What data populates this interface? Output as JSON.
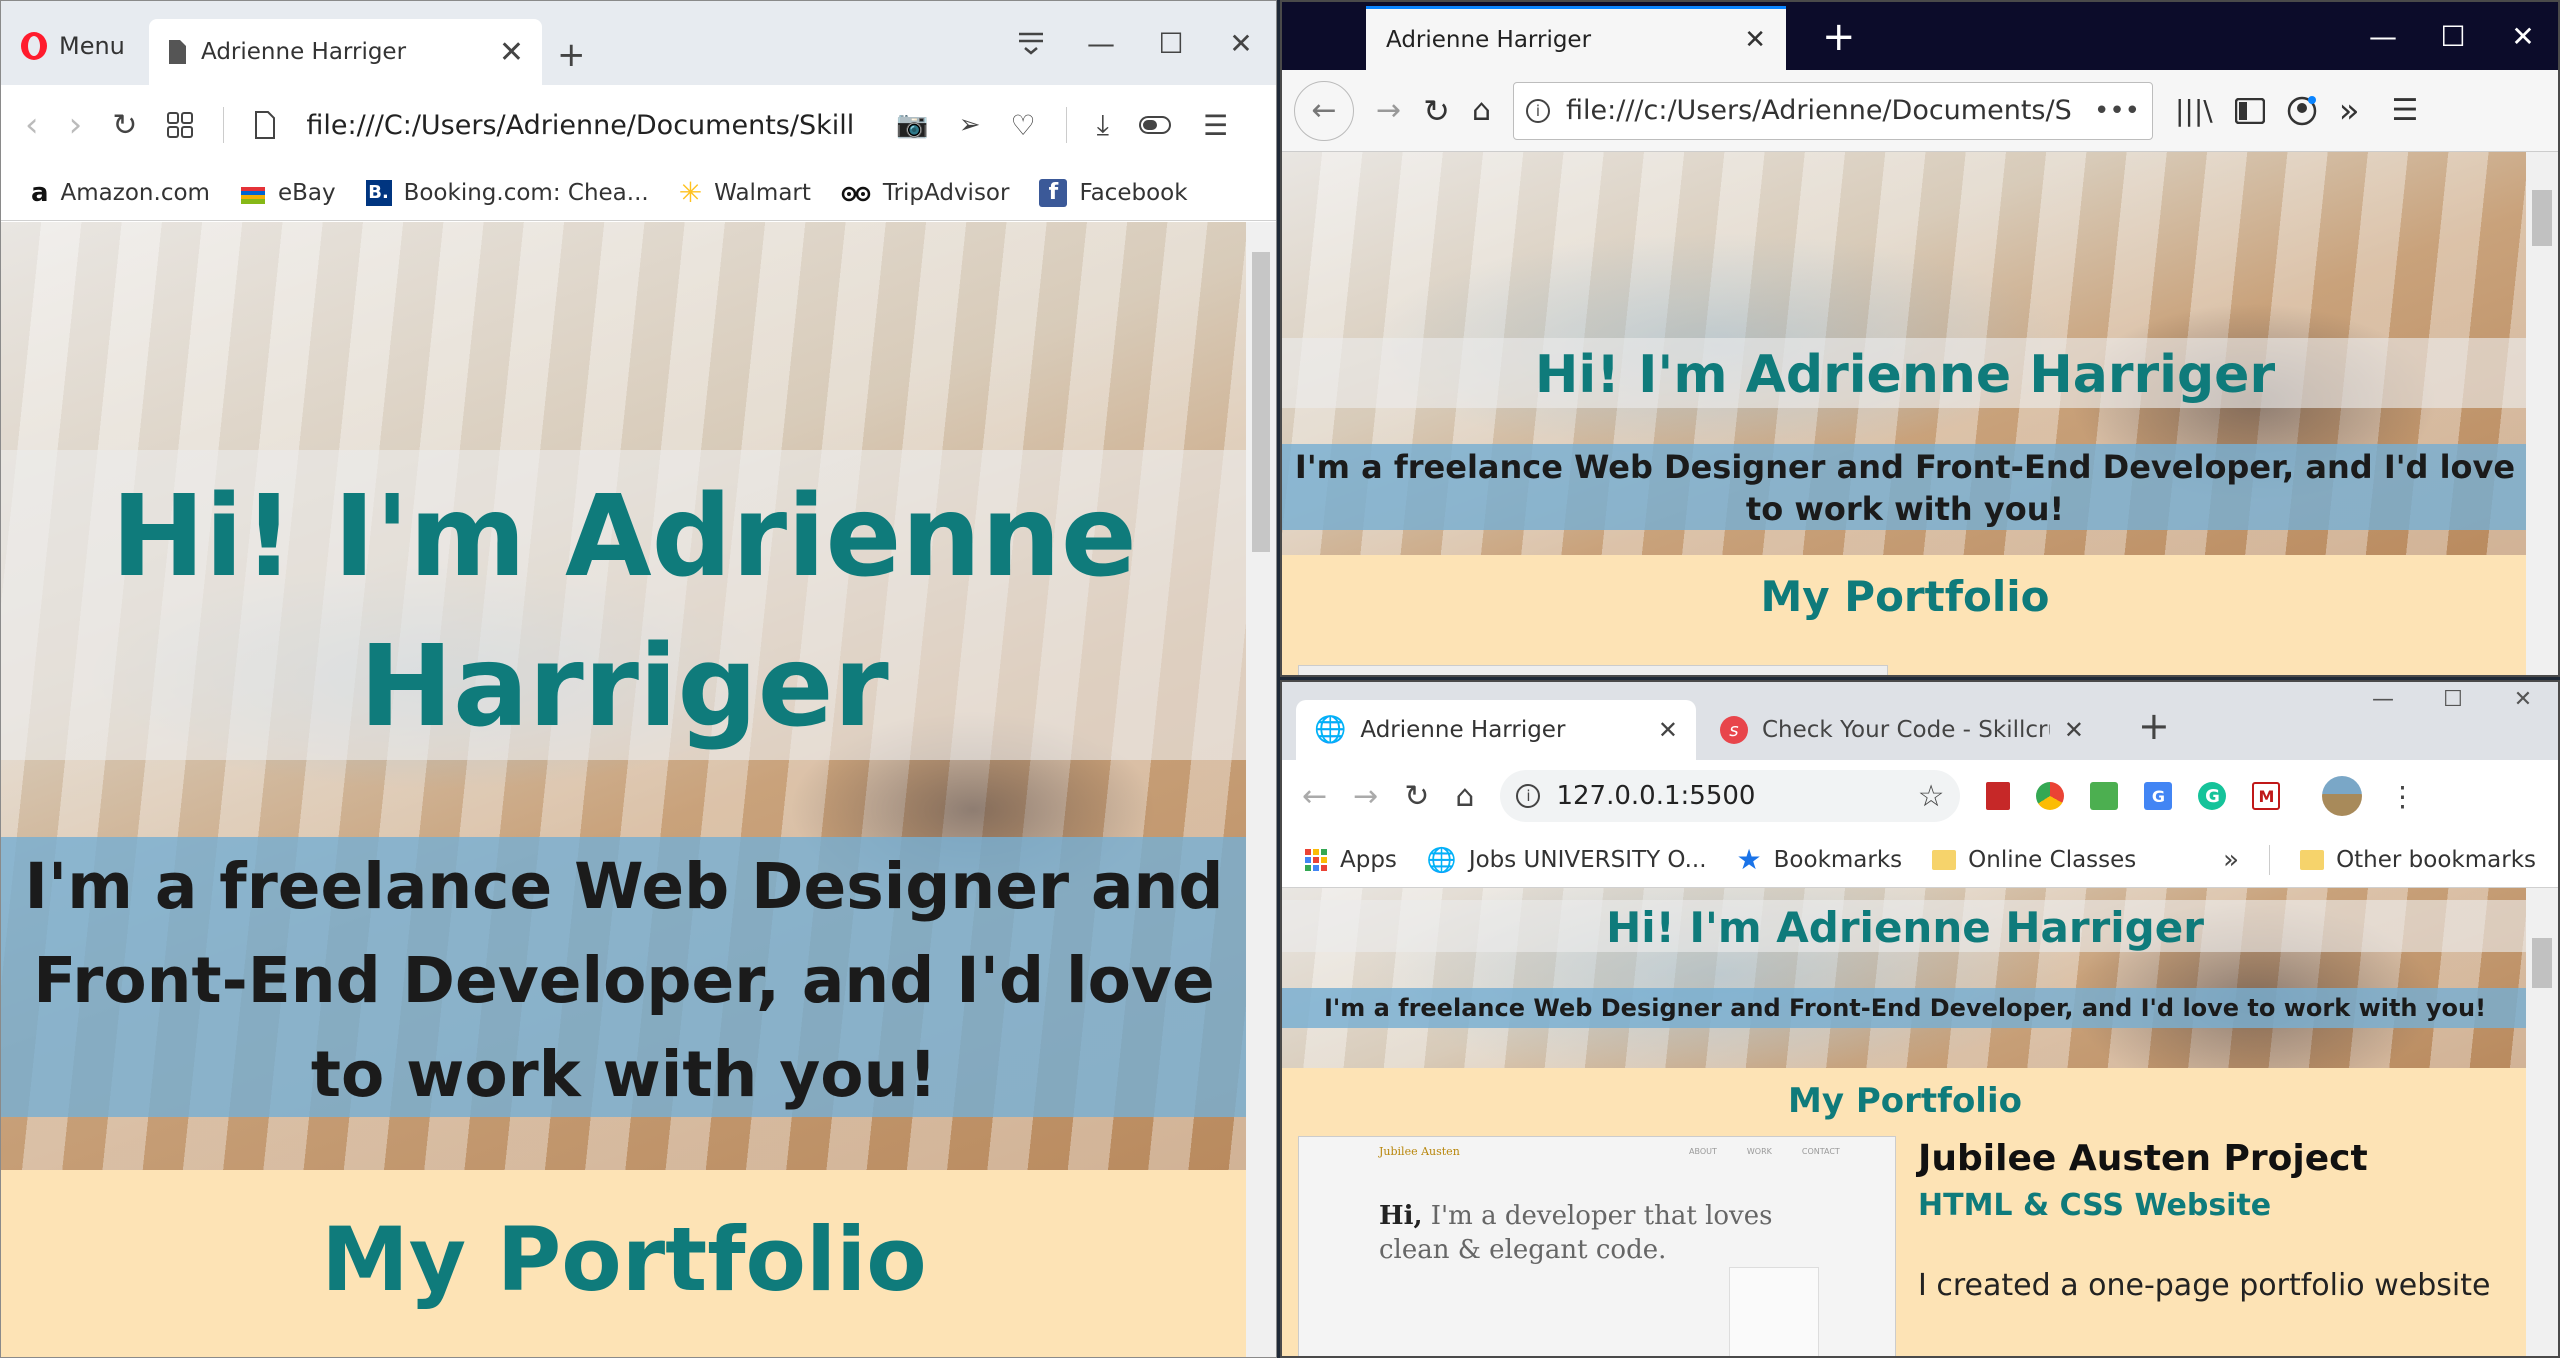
{
  "opera": {
    "menu_label": "Menu",
    "tab_title": "Adrienne Harriger",
    "url": "file:///C:/Users/Adrienne/Documents/Skill",
    "bookmarks": [
      "Amazon.com",
      "eBay",
      "Booking.com: Chea...",
      "Walmart",
      "TripAdvisor",
      "Facebook"
    ],
    "hero_title": "Hi! I'm Adrienne Harriger",
    "hero_tagline": "I'm a freelance Web Designer and Front-End Developer, and I'd love to work with you!",
    "section_title": "My Portfolio"
  },
  "firefox": {
    "tab_title": "Adrienne Harriger",
    "url": "file:///c:/Users/Adrienne/Documents/S",
    "more": "•••",
    "hero_title": "Hi! I'm Adrienne Harriger",
    "hero_tagline": "I'm a freelance Web Designer and Front-End Developer, and I'd love to work with you!",
    "section_title": "My Portfolio"
  },
  "chrome": {
    "tabs": [
      "Adrienne Harriger",
      "Check Your Code - Skillcru"
    ],
    "url": "127.0.0.1:5500",
    "bookmarks": [
      "Apps",
      "Jobs UNIVERSITY O...",
      "Bookmarks",
      "Online Classes"
    ],
    "overflow": "»",
    "other_bookmarks": "Other bookmarks",
    "hero_title": "Hi! I'm Adrienne Harriger",
    "hero_tagline": "I'm a freelance Web Designer and Front-End Developer, and I'd love to work with you!",
    "section_title": "My Portfolio",
    "thumb_brand": "Jubilee Austen",
    "thumb_nav": [
      "ABOUT",
      "WORK",
      "CONTACT"
    ],
    "thumb_hi": "Hi,",
    "thumb_line1": " I'm a developer that loves",
    "thumb_line2": "clean & elegant code.",
    "project_title": "Jubilee Austen Project",
    "project_subtitle": "HTML & CSS Website",
    "project_desc": "I created a one-page portfolio website"
  }
}
